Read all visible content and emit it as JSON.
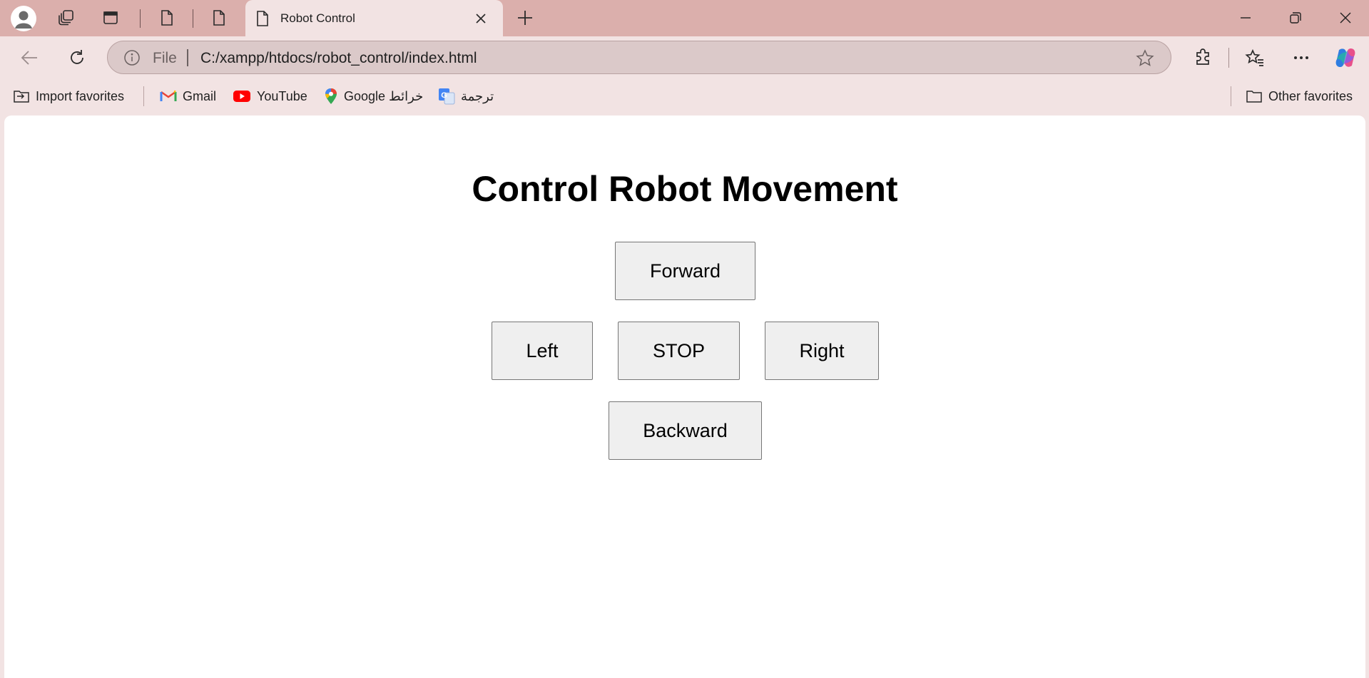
{
  "browser": {
    "active_tab_title": "Robot Control",
    "address": {
      "scheme_label": "File",
      "url": "C:/xampp/htdocs/robot_control/index.html"
    },
    "bookmarks": {
      "import_favorites": "Import favorites",
      "gmail": "Gmail",
      "youtube": "YouTube",
      "google_maps": "Google خرائط",
      "translate": "ترجمة",
      "other_favorites": "Other favorites"
    },
    "theme": {
      "titlebar": "#dbafac",
      "toolbar": "#f2e3e3",
      "omnibox": "#dbc9c9"
    }
  },
  "page": {
    "heading": "Control Robot Movement",
    "buttons": {
      "forward": "Forward",
      "left": "Left",
      "stop": "STOP",
      "right": "Right",
      "backward": "Backward"
    },
    "button_color": "#efefef"
  }
}
